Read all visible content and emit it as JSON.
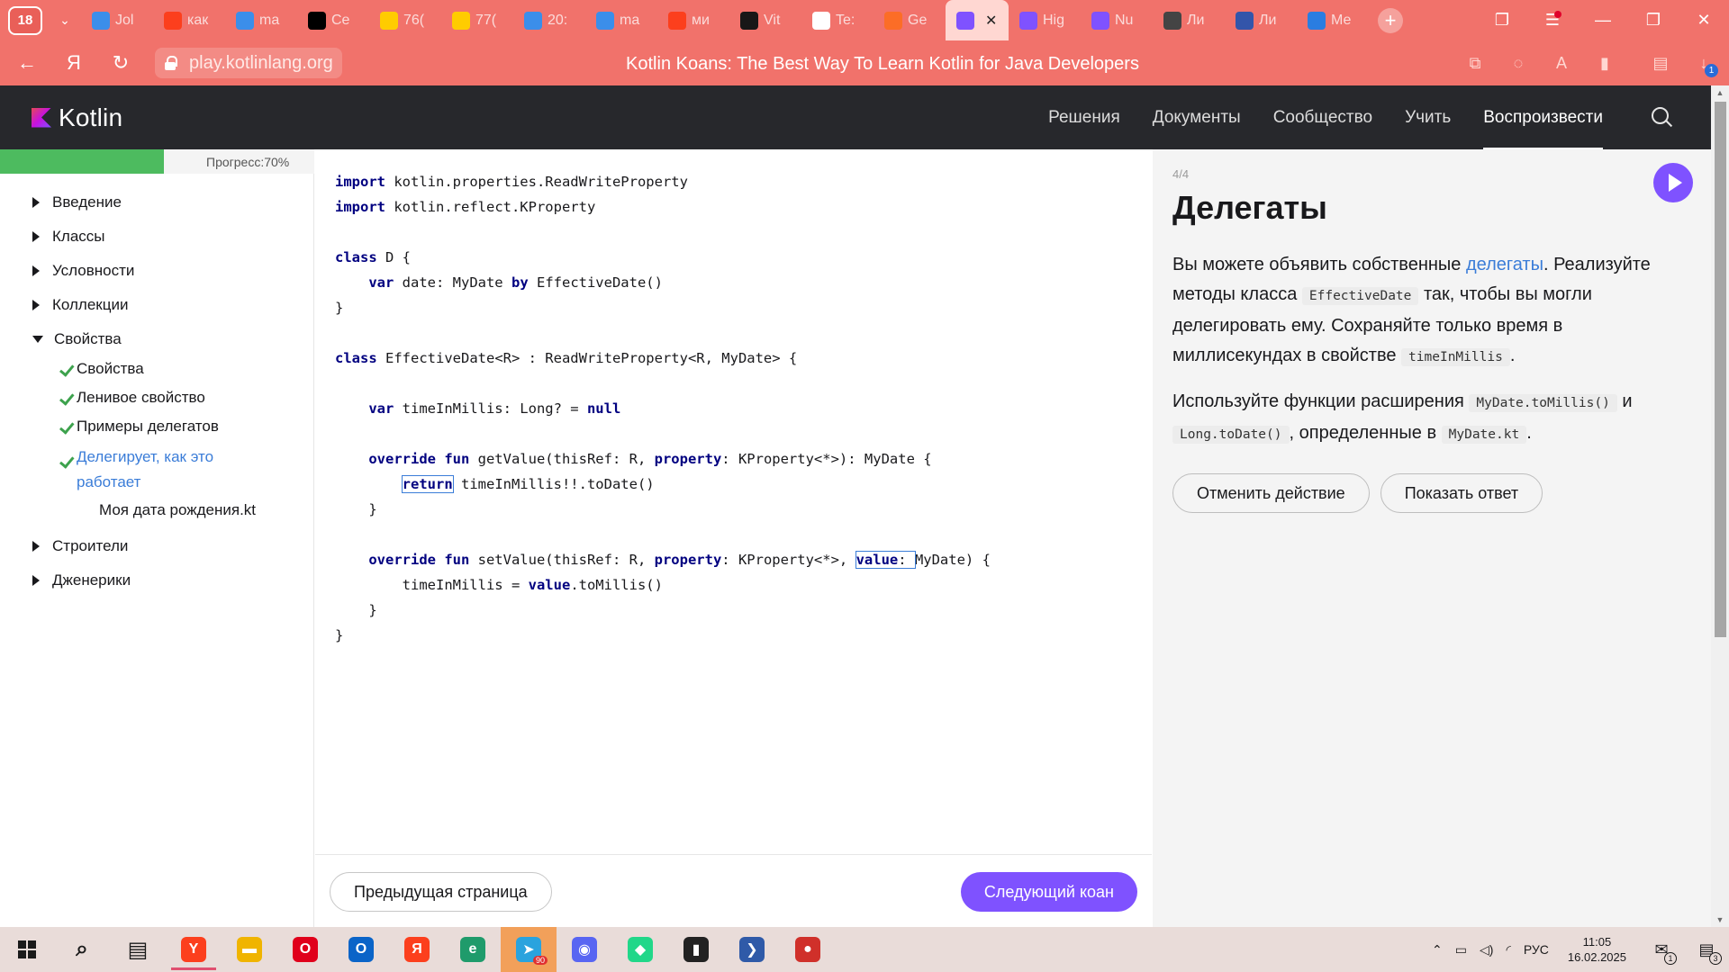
{
  "browser": {
    "tab_count": "18",
    "tabs": [
      {
        "title": "Jol",
        "icon": "cube-icon",
        "color": "#3b8eea"
      },
      {
        "title": "как",
        "icon": "yandex-icon",
        "color": "#fc3f1d"
      },
      {
        "title": "ma",
        "icon": "cube-icon",
        "color": "#3b8eea"
      },
      {
        "title": "Ce",
        "icon": "rider-icon",
        "color": "#000000"
      },
      {
        "title": "76(",
        "icon": "mail-icon",
        "color": "#ffcc00"
      },
      {
        "title": "77(",
        "icon": "mail-icon",
        "color": "#ffcc00"
      },
      {
        "title": "20:",
        "icon": "cube-icon",
        "color": "#3b8eea"
      },
      {
        "title": "ma",
        "icon": "cube-icon",
        "color": "#3b8eea"
      },
      {
        "title": "ми",
        "icon": "yandex-icon",
        "color": "#fc3f1d"
      },
      {
        "title": "Vit",
        "icon": "github-icon",
        "color": "#181717"
      },
      {
        "title": "Te:",
        "icon": "minus-circle-icon",
        "color": "#ffffff"
      },
      {
        "title": "Ge",
        "icon": "gitlab-icon",
        "color": "#fc6d26"
      },
      {
        "title": "",
        "icon": "kotlin-icon",
        "color": "#7f52ff",
        "active": true
      },
      {
        "title": "Hig",
        "icon": "kotlin-icon",
        "color": "#7f52ff"
      },
      {
        "title": "Nu",
        "icon": "kotlin-icon",
        "color": "#7f52ff"
      },
      {
        "title": "Ли",
        "icon": "globe-icon",
        "color": "#444444"
      },
      {
        "title": "Ли",
        "icon": "duck-icon",
        "color": "#3355aa"
      },
      {
        "title": "Ме",
        "icon": "chat-icon",
        "color": "#2a7de1"
      }
    ],
    "url": "play.kotlinlang.org",
    "page_title": "Kotlin Koans: The Best Way To Learn Kotlin for Java Developers",
    "downloads_badge": "1",
    "accent": "#f1726b"
  },
  "site": {
    "brand": "Kotlin",
    "nav": [
      "Решения",
      "Документы",
      "Сообщество",
      "Учить",
      "Воспроизвести"
    ],
    "active_nav": "Воспроизвести"
  },
  "sidebar": {
    "progress_label": "Прогресс:70%",
    "progress_value": 0.7,
    "sections": [
      {
        "label": "Введение",
        "expanded": false
      },
      {
        "label": "Классы",
        "expanded": false
      },
      {
        "label": "Условности",
        "expanded": false
      },
      {
        "label": "Коллекции",
        "expanded": false
      },
      {
        "label": "Свойства",
        "expanded": true
      },
      {
        "label": "Строители",
        "expanded": false
      },
      {
        "label": "Дженерики",
        "expanded": false
      }
    ],
    "property_items": [
      {
        "label": "Свойства",
        "done": true
      },
      {
        "label": "Ленивое свойство",
        "done": true
      },
      {
        "label": "Примеры делегатов",
        "done": true
      },
      {
        "label": "Делегирует, как это работает",
        "done": true,
        "current": true
      }
    ],
    "file": "Моя дата рождения.kt"
  },
  "editor": {
    "prev_button": "Предыдущая страница",
    "next_button": "Следующий коан"
  },
  "task": {
    "counter": "4/4",
    "title": "Делегаты",
    "p1_a": "Вы можете объявить собственные ",
    "p1_link": "делегаты",
    "p1_b": ". Реализуйте методы класса ",
    "p1_code1": "EffectiveDate",
    "p1_c": " так, чтобы вы могли делегировать ему. Сохраняйте только время в миллисекундах в свойстве ",
    "p1_code2": "timeInMillis",
    "p1_d": ".",
    "p2_a": "Используйте функции расширения ",
    "p2_code1": "MyDate.toMillis()",
    "p2_b": " и ",
    "p2_code2": "Long.toDate()",
    "p2_c": ", определенные в ",
    "p2_code3": "MyDate.kt",
    "p2_d": ".",
    "undo_button": "Отменить действие",
    "show_answer_button": "Показать ответ",
    "run_accent": "#7f52ff"
  },
  "taskbar": {
    "apps": [
      {
        "name": "search-icon",
        "glyph": "⌕",
        "color": "#1a1a1a"
      },
      {
        "name": "task-view-icon",
        "glyph": "▤",
        "color": "#1a1a1a"
      },
      {
        "name": "yandex-browser-icon",
        "glyph": "Y",
        "color": "#fc3f1d",
        "running": true
      },
      {
        "name": "file-explorer-icon",
        "glyph": "▬",
        "color": "#f0b400"
      },
      {
        "name": "opera-icon",
        "glyph": "O",
        "color": "#e0001b"
      },
      {
        "name": "outlook-icon",
        "glyph": "O",
        "color": "#0a64c8"
      },
      {
        "name": "yandex-icon",
        "glyph": "Я",
        "color": "#fc3f1d"
      },
      {
        "name": "edge-icon",
        "glyph": "e",
        "color": "#1f9b6b"
      },
      {
        "name": "telegram-icon",
        "glyph": "➤",
        "color": "#2aa3de",
        "badge": "90",
        "highlight": true
      },
      {
        "name": "discord-icon",
        "glyph": "◉",
        "color": "#5865f2"
      },
      {
        "name": "toolbox-icon",
        "glyph": "◆",
        "color": "#21d789"
      },
      {
        "name": "terminal-icon",
        "glyph": "▮",
        "color": "#222222"
      },
      {
        "name": "powershell-icon",
        "glyph": "❯",
        "color": "#2f5aa8"
      },
      {
        "name": "ruby-icon",
        "glyph": "●",
        "color": "#d0302a"
      }
    ],
    "lang": "РУС",
    "time": "11:05",
    "date": "16.02.2025",
    "tray_badge": "1",
    "notif_badge": "3"
  }
}
